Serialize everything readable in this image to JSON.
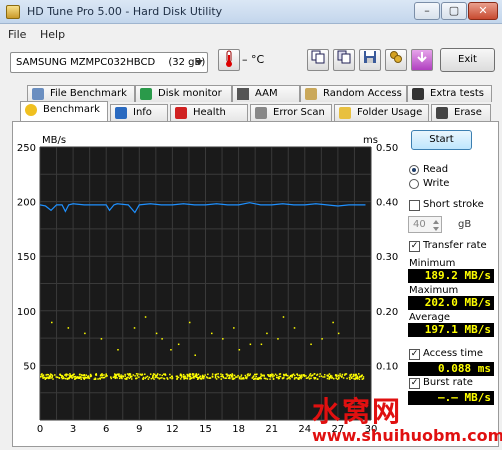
{
  "window": {
    "title": "HD Tune Pro 5.00 - Hard Disk Utility"
  },
  "menu": {
    "file": "File",
    "help": "Help"
  },
  "toolbar": {
    "drive": "SAMSUNG MZMPC032HBCD",
    "drive_size": "(32 gB)",
    "temperature": "– °C",
    "exit_label": "Exit"
  },
  "tabs_top": [
    {
      "label": "File Benchmark"
    },
    {
      "label": "Disk monitor"
    },
    {
      "label": "AAM"
    },
    {
      "label": "Random Access"
    },
    {
      "label": "Extra tests"
    }
  ],
  "tabs_bottom": [
    {
      "label": "Benchmark"
    },
    {
      "label": "Info"
    },
    {
      "label": "Health"
    },
    {
      "label": "Error Scan"
    },
    {
      "label": "Folder Usage"
    },
    {
      "label": "Erase"
    }
  ],
  "side": {
    "start_label": "Start",
    "read_label": "Read",
    "write_label": "Write",
    "short_stroke_label": "Short stroke",
    "short_stroke_value": "40",
    "short_stroke_unit": "gB",
    "transfer_rate_label": "Transfer rate",
    "minimum_label": "Minimum",
    "minimum_value": "189.2 MB/s",
    "maximum_label": "Maximum",
    "maximum_value": "202.0 MB/s",
    "average_label": "Average",
    "average_value": "197.1 MB/s",
    "access_time_label": "Access time",
    "access_time_value": "0.088 ms",
    "burst_rate_label": "Burst rate",
    "burst_rate_value": "–.– MB/s"
  },
  "chart_data": {
    "type": "line",
    "y_left_unit": "MB/s",
    "y_right_unit": "ms",
    "ylim_left": [
      0,
      250
    ],
    "ylim_right": [
      0,
      0.5
    ],
    "xlim": [
      0,
      30
    ],
    "x_ticks": [
      "0",
      "3",
      "6",
      "9",
      "12",
      "15",
      "18",
      "21",
      "24",
      "27",
      "30"
    ],
    "y_left_ticks": [
      "50",
      "100",
      "150",
      "200",
      "250"
    ],
    "y_right_ticks": [
      "0.10",
      "0.20",
      "0.30",
      "0.40",
      "0.50"
    ],
    "grid": true,
    "series": [
      {
        "name": "Transfer rate",
        "color": "#1e90ff",
        "x": [
          0,
          0.5,
          1,
          1.5,
          2,
          2.3,
          2.6,
          3,
          4,
          5,
          6,
          6.3,
          6.7,
          7,
          8,
          8.6,
          9,
          10,
          11,
          12,
          13,
          14,
          15,
          16,
          17,
          18,
          19,
          20,
          21,
          22,
          23,
          24,
          25,
          26,
          27,
          28,
          29,
          29.5
        ],
        "y": [
          197,
          196,
          192,
          197,
          197,
          191,
          197,
          198,
          197,
          197,
          197,
          192,
          197,
          198,
          197,
          190,
          197,
          198,
          197,
          197,
          198,
          197,
          197,
          198,
          197,
          197,
          199,
          197,
          197,
          198,
          197,
          197,
          198,
          197,
          196,
          197,
          197,
          197
        ]
      },
      {
        "name": "Access time",
        "color": "#ffff00",
        "base_ms": 0.08,
        "scatter_high_ms": [
          0.18,
          0.17,
          0.16,
          0.15,
          0.13,
          0.17,
          0.19,
          0.16,
          0.15,
          0.14,
          0.18,
          0.12,
          0.16,
          0.15,
          0.17,
          0.13,
          0.14,
          0.16,
          0.15,
          0.19,
          0.17,
          0.14,
          0.15,
          0.18,
          0.16,
          0.13,
          0.14
        ],
        "scatter_high_x": [
          1,
          2.5,
          4,
          5.5,
          7,
          8.5,
          9.5,
          10.5,
          11,
          12.5,
          13.5,
          14,
          15.5,
          16.5,
          17.5,
          18,
          19,
          20.5,
          21.5,
          22,
          23,
          24.5,
          25.5,
          26.5,
          27,
          11.8,
          20
        ]
      }
    ]
  },
  "watermark": {
    "cn": "水窝网",
    "url": "www.shuihuobm.com"
  }
}
